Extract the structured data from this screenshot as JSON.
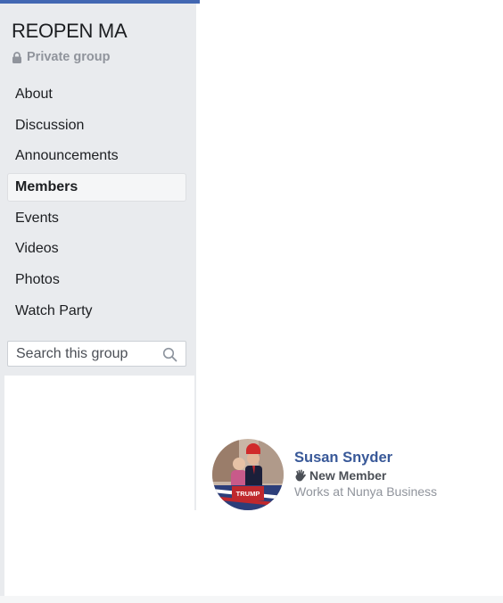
{
  "group": {
    "name": "REOPEN MA",
    "privacy": "Private group",
    "privacy_icon": "lock-icon"
  },
  "nav": {
    "items": [
      {
        "label": "About"
      },
      {
        "label": "Discussion"
      },
      {
        "label": "Announcements"
      },
      {
        "label": "Members",
        "active": true
      },
      {
        "label": "Events"
      },
      {
        "label": "Videos"
      },
      {
        "label": "Photos"
      },
      {
        "label": "Watch Party"
      }
    ]
  },
  "search": {
    "placeholder": "Search this group",
    "icon": "search-icon"
  },
  "member": {
    "name": "Susan Snyder",
    "badge": "New Member",
    "badge_icon": "waving-hand-icon",
    "work": "Works at Nunya Business",
    "avatar_text": "TRUMP"
  },
  "colors": {
    "accent": "#4267b2",
    "link": "#385898",
    "sidebar_bg": "#e9ebee"
  }
}
